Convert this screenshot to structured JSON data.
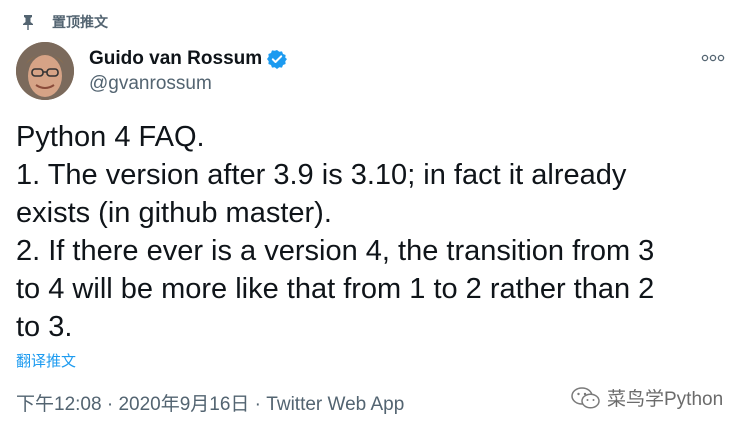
{
  "pinned": {
    "label": "置顶推文",
    "icon": "pin-icon"
  },
  "author": {
    "name": "Guido van Rossum",
    "handle": "@gvanrossum",
    "verified": true,
    "verified_color": "#1d9bf0"
  },
  "tweet": {
    "lines": [
      "Python 4 FAQ.",
      "1. The version after 3.9 is 3.10; in fact it already",
      "exists (in github master).",
      "2. If there ever is a version 4, the transition from 3",
      "to 4 will be more like that from 1 to 2 rather than 2",
      "to 3."
    ],
    "translate_label": "翻译推文"
  },
  "meta": {
    "time": "下午12:08",
    "separator": " · ",
    "date": "2020年9月16日",
    "app": "Twitter Web App"
  },
  "watermark": {
    "text": "菜鸟学Python",
    "icon": "wechat-icon"
  }
}
